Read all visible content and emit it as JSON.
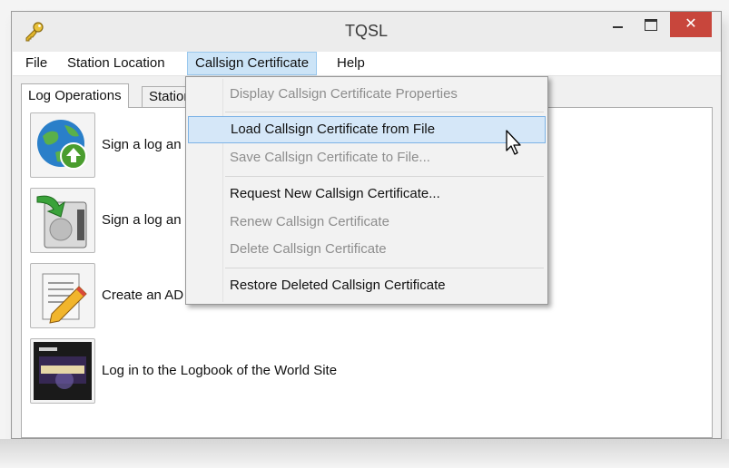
{
  "window": {
    "title": "TQSL",
    "close_glyph": "✕",
    "icon": "key-icon"
  },
  "menubar": {
    "items": [
      {
        "label": "File"
      },
      {
        "label": "Station Location"
      },
      {
        "label": "Callsign Certificate"
      },
      {
        "label": "Help"
      }
    ],
    "open_menu": "Callsign Certificate"
  },
  "tabs": [
    {
      "label": "Log Operations",
      "selected": true
    },
    {
      "label": "Stations",
      "selected": false
    }
  ],
  "actions": [
    {
      "label": "Sign a log an",
      "icon": "globe-upload-icon"
    },
    {
      "label": "Sign a log an",
      "icon": "save-upload-icon"
    },
    {
      "label": "Create an AD",
      "icon": "edit-document-icon"
    },
    {
      "label": "Log in to the Logbook of the World Site",
      "icon": "lotw-logo-icon"
    }
  ],
  "dropdown": {
    "items": [
      {
        "label": "Display Callsign Certificate Properties",
        "enabled": false
      },
      {
        "label": "Load Callsign Certificate from File",
        "enabled": true,
        "highlighted": true
      },
      {
        "label": "Save Callsign Certificate to File...",
        "enabled": false
      },
      {
        "label": "Request New Callsign Certificate...",
        "enabled": true
      },
      {
        "label": "Renew Callsign Certificate",
        "enabled": false
      },
      {
        "label": "Delete Callsign Certificate",
        "enabled": false
      },
      {
        "label": "Restore Deleted Callsign Certificate",
        "enabled": true
      }
    ]
  },
  "colors": {
    "close_button": "#c8463c",
    "menu_highlight": "#cce4f7",
    "item_hover": "#d5e7f8"
  }
}
